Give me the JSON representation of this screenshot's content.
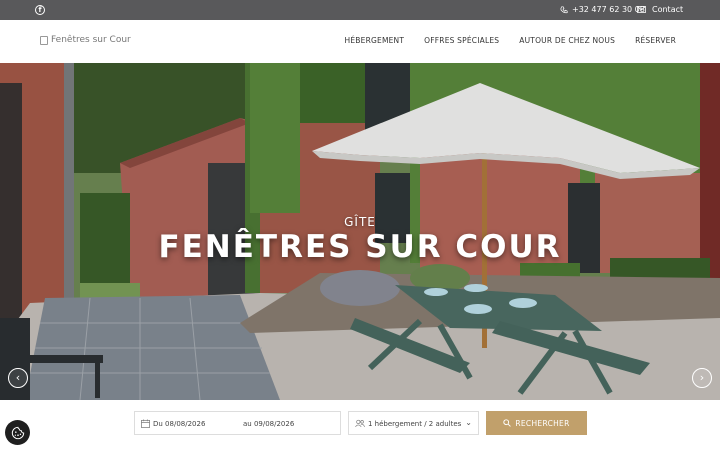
{
  "topbar": {
    "facebook_icon": "facebook-icon",
    "phone": "+32 477 62 30 08",
    "contact": "Contact"
  },
  "nav": {
    "logo_alt": "Fenêtres sur Cour",
    "items": [
      "HÉBERGEMENT",
      "OFFRES SPÉCIALES",
      "AUTOUR DE CHEZ NOUS",
      "RÉSERVER"
    ]
  },
  "hero": {
    "subtitle": "GÎTE",
    "title": "FENÊTRES SUR COUR",
    "prev_icon": "chevron-left-icon",
    "next_icon": "chevron-right-icon"
  },
  "booking": {
    "date_from": "Du 08/08/2026",
    "date_to": "au 09/08/2026",
    "guests": "1 hébergement / 2 adultes",
    "search_label": "RECHERCHER"
  },
  "colors": {
    "topbar": "#59595b",
    "accent": "#c1a06b",
    "cookie_button": "#1f1f1f"
  }
}
